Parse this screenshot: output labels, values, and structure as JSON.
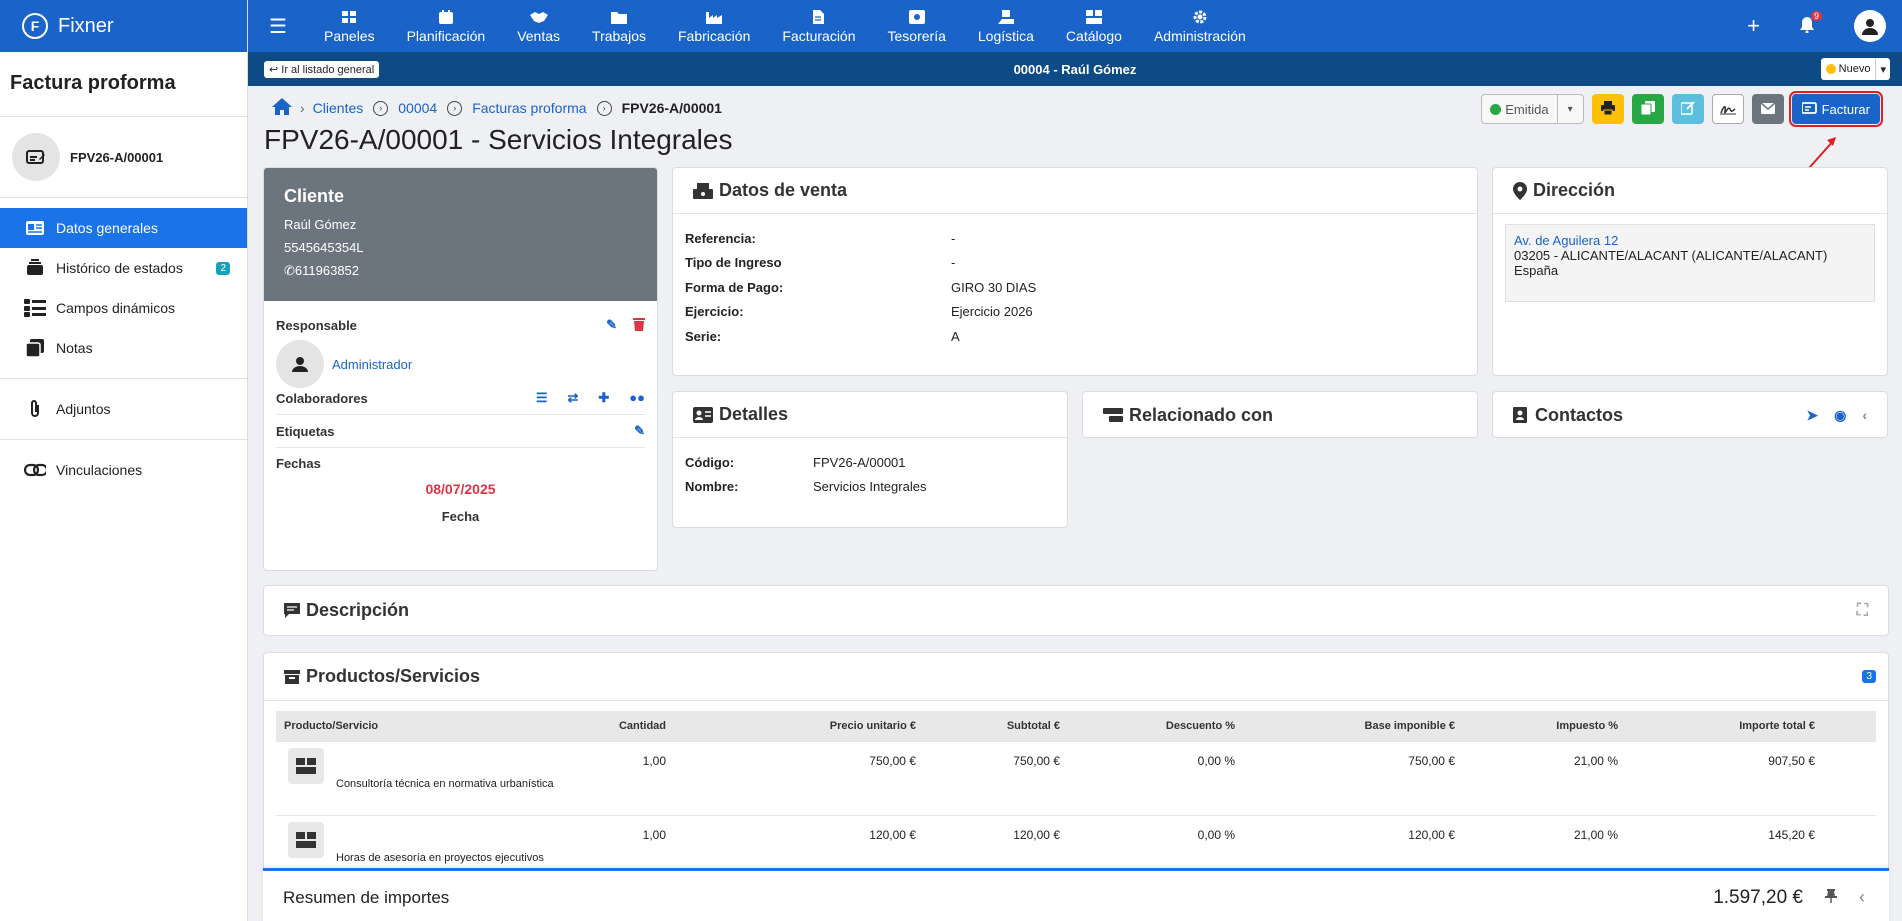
{
  "app": {
    "name": "Fixner"
  },
  "sidebar": {
    "title": "Factura proforma",
    "doc_label": "FPV26-A/00001",
    "items": [
      {
        "label": "Datos generales",
        "icon": "id-card-icon",
        "active": true
      },
      {
        "label": "Histórico de estados",
        "icon": "layers-icon",
        "badge": "2"
      },
      {
        "label": "Campos dinámicos",
        "icon": "list-fields-icon"
      },
      {
        "label": "Notas",
        "icon": "notes-icon"
      },
      {
        "label": "Adjuntos",
        "icon": "paperclip-icon"
      },
      {
        "label": "Vinculaciones",
        "icon": "link-icon"
      }
    ]
  },
  "topnav": {
    "items": [
      {
        "label": "Paneles",
        "icon": "dashboard-icon"
      },
      {
        "label": "Planificación",
        "icon": "calendar-icon"
      },
      {
        "label": "Ventas",
        "icon": "handshake-icon"
      },
      {
        "label": "Trabajos",
        "icon": "folder-icon"
      },
      {
        "label": "Fabricación",
        "icon": "factory-icon"
      },
      {
        "label": "Facturación",
        "icon": "invoice-icon"
      },
      {
        "label": "Tesorería",
        "icon": "money-icon"
      },
      {
        "label": "Logística",
        "icon": "delivery-icon"
      },
      {
        "label": "Catálogo",
        "icon": "catalog-icon"
      },
      {
        "label": "Administración",
        "icon": "gear-icon"
      }
    ],
    "notifications": "9"
  },
  "subbar": {
    "back_label": "Ir al listado general",
    "title": "00004 - Raúl Gómez",
    "status": "Nuevo"
  },
  "breadcrumb": {
    "clients": "Clientes",
    "code": "00004",
    "section": "Facturas proforma",
    "current": "FPV26-A/00001"
  },
  "page_title": "FPV26-A/00001 - Servicios Integrales",
  "actions": {
    "status": "Emitida",
    "facturar": "Facturar"
  },
  "client": {
    "heading": "Cliente",
    "name": "Raúl Gómez",
    "nif": "5545645354L",
    "phone": "611963852",
    "responsable_label": "Responsable",
    "responsable": "Administrador",
    "colaboradores_label": "Colaboradores",
    "etiquetas_label": "Etiquetas",
    "fechas_label": "Fechas",
    "date": "08/07/2025",
    "date_caption": "Fecha"
  },
  "venta": {
    "title": "Datos de venta",
    "rows": [
      {
        "k": "Referencia:",
        "v": "-"
      },
      {
        "k": "Tipo de Ingreso",
        "v": "-"
      },
      {
        "k": "Forma de Pago:",
        "v": "GIRO 30 DIAS"
      },
      {
        "k": "Ejercicio:",
        "v": "Ejercicio 2026"
      },
      {
        "k": "Serie:",
        "v": "A"
      }
    ]
  },
  "direccion": {
    "title": "Dirección",
    "street": "Av. de Aguilera 12",
    "city": "03205 - ALICANTE/ALACANT (ALICANTE/ALACANT)",
    "country": "España"
  },
  "detalles": {
    "title": "Detalles",
    "rows": [
      {
        "k": "Código:",
        "v": "FPV26-A/00001"
      },
      {
        "k": "Nombre:",
        "v": "Servicios Integrales"
      }
    ]
  },
  "relacionado": {
    "title": "Relacionado con"
  },
  "contactos": {
    "title": "Contactos"
  },
  "descripcion": {
    "title": "Descripción"
  },
  "productos": {
    "title": "Productos/Servicios",
    "count": "3",
    "columns": [
      "Producto/Servicio",
      "Cantidad",
      "Precio unitario €",
      "Subtotal €",
      "Descuento %",
      "Base imponible €",
      "Impuesto %",
      "Importe total €"
    ],
    "rows": [
      {
        "name": "Consultoría técnica en normativa urbanística",
        "qty": "1,00",
        "price": "750,00 €",
        "subtotal": "750,00 €",
        "discount": "0,00 %",
        "base": "750,00 €",
        "tax": "21,00 %",
        "total": "907,50 €"
      },
      {
        "name": "Horas de asesoría en proyectos ejecutivos",
        "qty": "1,00",
        "price": "120,00 €",
        "subtotal": "120,00 €",
        "discount": "0,00 %",
        "base": "120,00 €",
        "tax": "21,00 %",
        "total": "145,20 €"
      }
    ]
  },
  "summary": {
    "label": "Resumen de importes",
    "total": "1.597,20 €"
  },
  "colors": {
    "primary": "#1a63c8",
    "dark": "#0d4a86",
    "active": "#1a73e8",
    "danger": "#dc3545",
    "success": "#28a745",
    "warning": "#ffc107",
    "info": "#5bc0de"
  }
}
